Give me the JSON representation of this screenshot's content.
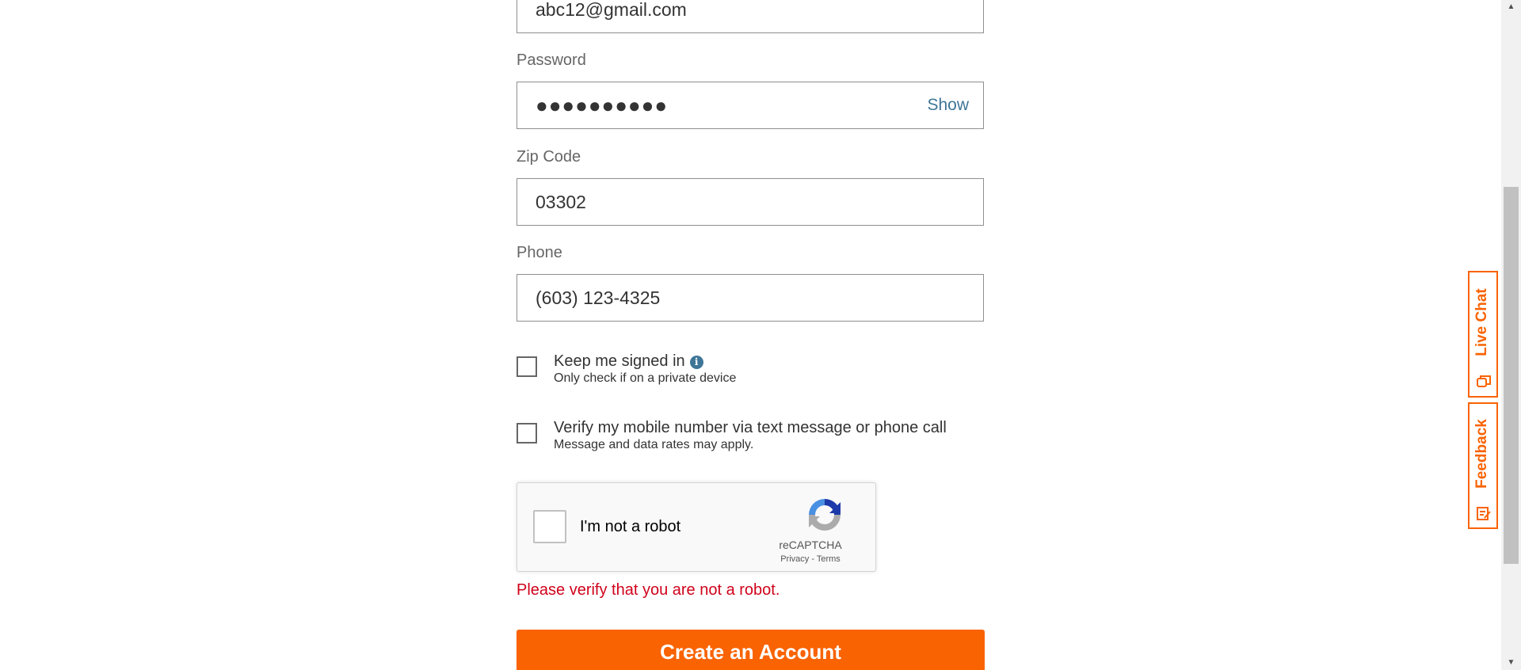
{
  "form": {
    "email": {
      "value": "abc12@gmail.com"
    },
    "password": {
      "label": "Password",
      "value": "●●●●●●●●●●",
      "show_label": "Show"
    },
    "zip": {
      "label": "Zip Code",
      "value": "03302"
    },
    "phone": {
      "label": "Phone",
      "value": "(603) 123-4325"
    },
    "keep_signed_in": {
      "title": "Keep me signed in",
      "subtitle": "Only check if on a private device",
      "info_icon": "info-icon",
      "checked": false
    },
    "verify_mobile": {
      "title": "Verify my mobile number via text message or phone call",
      "subtitle": "Message and data rates may apply.",
      "checked": false
    },
    "recaptcha": {
      "label": "I'm not a robot",
      "brand": "reCAPTCHA",
      "privacy": "Privacy",
      "separator": "-",
      "terms": "Terms",
      "checked": false
    },
    "error": "Please verify that you are not a robot.",
    "submit_label": "Create an Account"
  },
  "side_tabs": {
    "live_chat": "Live Chat",
    "feedback": "Feedback"
  },
  "colors": {
    "accent": "#f96302",
    "link": "#3e7697",
    "error": "#d0021b"
  }
}
